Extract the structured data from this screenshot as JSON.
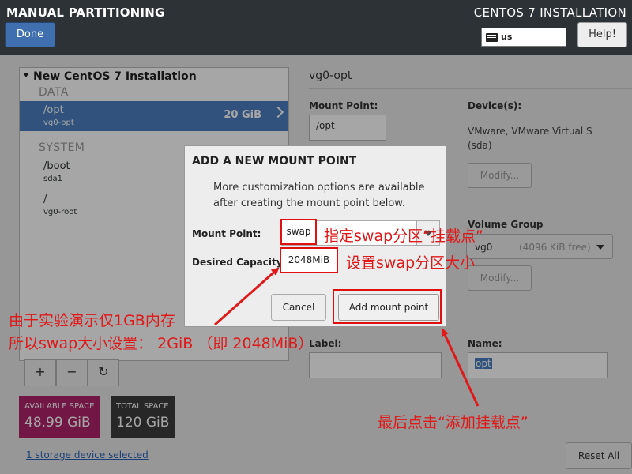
{
  "header": {
    "title": "MANUAL PARTITIONING",
    "product": "CENTOS 7 INSTALLATION",
    "done_label": "Done",
    "keyboard_layout": "us",
    "help_label": "Help!"
  },
  "partitions": {
    "root_label": "New CentOS 7 Installation",
    "groups": [
      {
        "label": "DATA"
      },
      {
        "label": "SYSTEM"
      }
    ],
    "items": [
      {
        "name": "/opt",
        "device": "vg0-opt",
        "size": "20 GiB",
        "selected": true
      },
      {
        "name": "/boot",
        "device": "sda1",
        "size": ""
      },
      {
        "name": "/",
        "device": "vg0-root",
        "size": ""
      }
    ],
    "tools": {
      "add": "+",
      "remove": "−",
      "refresh": "↻"
    }
  },
  "space": {
    "available_label": "AVAILABLE SPACE",
    "available_value": "48.99 GiB",
    "total_label": "TOTAL SPACE",
    "total_value": "120 GiB",
    "available_color": "#b0246a",
    "total_color": "#3c3c3c"
  },
  "storage_link": "1 storage device selected",
  "details": {
    "title": "vg0-opt",
    "mount_point_label": "Mount Point:",
    "mount_point_value": "/opt",
    "devices_label": "Device(s):",
    "devices_value_1": "VMware, VMware Virtual S",
    "devices_value_2": "(sda)",
    "modify_label": "Modify...",
    "volume_group_label": "Volume Group",
    "volume_group_value": "vg0",
    "volume_group_free": "(4096 KiB free)",
    "modify2_label": "Modify...",
    "label_label": "Label:",
    "name_label": "Name:",
    "name_value": "opt",
    "reset_label": "Reset All"
  },
  "dialog": {
    "title": "ADD A NEW MOUNT POINT",
    "description": "More customization options are available after creating the mount point below.",
    "mount_point_label": "Mount Point:",
    "mount_point_value": "swap",
    "capacity_label": "Desired Capacity:",
    "capacity_value": "2048MiB",
    "cancel_label": "Cancel",
    "add_label": "Add mount point"
  },
  "annotations": {
    "mount_point_note": "指定swap分区“挂载点”",
    "capacity_note": "设置swap分区大小",
    "memory_note_1": "由于实验演示仅1GB内存",
    "memory_note_2": "所以swap大小设置： 2GiB （即 2048MiB）",
    "click_note": "最后点击“添加挂载点”",
    "color": "#e01818"
  }
}
